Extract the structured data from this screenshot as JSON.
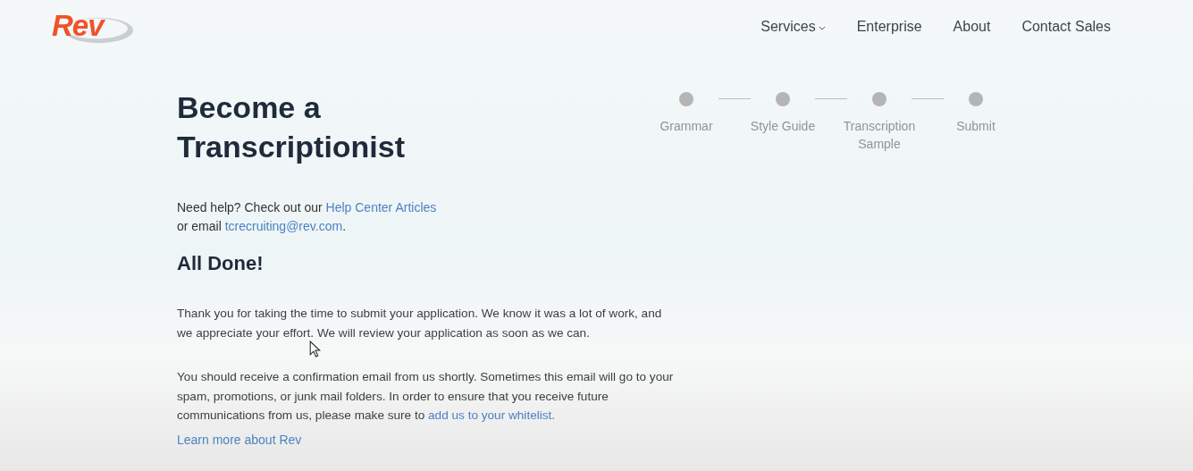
{
  "header": {
    "logo": "Rev",
    "nav": [
      {
        "label": "Services",
        "dropdown": true
      },
      {
        "label": "Enterprise",
        "dropdown": false
      },
      {
        "label": "About",
        "dropdown": false
      },
      {
        "label": "Contact Sales",
        "dropdown": false
      }
    ]
  },
  "title": "Become a Transcriptionist",
  "help": [
    [
      {
        "kind": "text",
        "text": "Need help? Check out our "
      },
      {
        "kind": "link",
        "text": "Help Center Articles"
      }
    ],
    [
      {
        "kind": "text",
        "text": "or email "
      },
      {
        "kind": "link",
        "text": "tcrecruiting@rev.com"
      },
      {
        "kind": "text",
        "text": "."
      }
    ]
  ],
  "steps": [
    {
      "label": "Grammar"
    },
    {
      "label": "Style Guide"
    },
    {
      "label": "Transcription Sample"
    },
    {
      "label": "Submit"
    }
  ],
  "heading": "All Done!",
  "paragraphs": [
    [
      {
        "kind": "text",
        "text": "Thank you for taking the time to submit your application. We know it was a lot of work, and we appreciate your effort. We will review your application as soon as we can."
      }
    ],
    [
      {
        "kind": "text",
        "text": "You should receive a confirmation email from us shortly. Sometimes this email will go to your spam, promotions, or junk mail folders. In order to ensure that you receive future communications from us, please make sure to "
      },
      {
        "kind": "link",
        "text": "add us to your whitelist."
      }
    ]
  ],
  "footer_link": "Learn more about Rev"
}
